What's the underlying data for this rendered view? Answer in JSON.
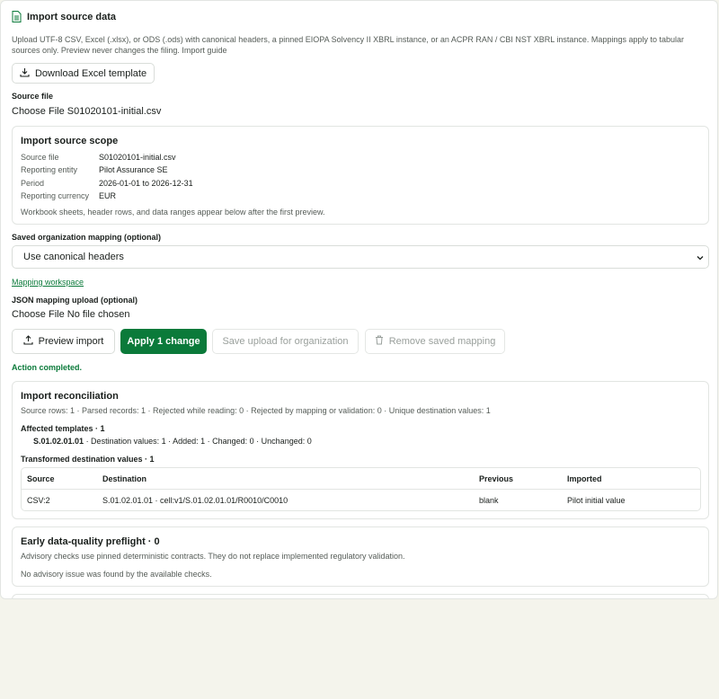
{
  "header": {
    "title": "Import source data",
    "icon": "file-spreadsheet-icon"
  },
  "description": "Upload UTF-8 CSV, Excel (.xlsx), or ODS (.ods) with canonical headers, a pinned EIOPA Solvency II XBRL instance, or an ACPR RAN / CBI NST XBRL instance. Mappings apply to tabular sources only. Preview never changes the filing. Import guide",
  "download_button": "Download Excel template",
  "source_file": {
    "label": "Source file",
    "chooser": "Choose File S01020101-initial.csv"
  },
  "scope": {
    "title": "Import source scope",
    "rows": [
      {
        "key": "Source file",
        "value": "S01020101-initial.csv"
      },
      {
        "key": "Reporting entity",
        "value": "Pilot Assurance SE"
      },
      {
        "key": "Period",
        "value": "2026-01-01 to 2026-12-31"
      },
      {
        "key": "Reporting currency",
        "value": "EUR"
      }
    ],
    "note": "Workbook sheets, header rows, and data ranges appear below after the first preview."
  },
  "saved_mapping": {
    "label": "Saved organization mapping (optional)",
    "selected": "Use canonical headers"
  },
  "mapping_link": "Mapping workspace",
  "json_mapping": {
    "label": "JSON mapping upload (optional)",
    "chooser": "Choose File No file chosen"
  },
  "actions": {
    "preview": "Preview import",
    "apply": "Apply 1 change",
    "save": "Save upload for organization",
    "remove": "Remove saved mapping"
  },
  "status": "Action completed.",
  "reconciliation": {
    "title": "Import reconciliation",
    "summary": "Source rows: 1 · Parsed records: 1 · Rejected while reading: 0 · Rejected by mapping or validation: 0 · Unique destination values: 1",
    "affected_heading": "Affected templates · 1",
    "template_code": "S.01.02.01.01",
    "template_detail": " · Destination values: 1 · Added: 1 · Changed: 0 · Unchanged: 0",
    "transformed_heading": "Transformed destination values · 1",
    "columns": [
      "Source",
      "Destination",
      "Previous",
      "Imported"
    ],
    "row": [
      "CSV:2",
      "S.01.02.01.01 · cell:v1/S.01.02.01.01/R0010/C0010",
      "blank",
      "Pilot initial value"
    ]
  },
  "preflight": {
    "title": "Early data-quality preflight · 0",
    "note": "Advisory checks use pinned deterministic contracts. They do not replace implemented regulatory validation.",
    "result": "No advisory issue was found by the available checks."
  },
  "colors": {
    "accent": "#0b7a3a",
    "background": "#f4f4ec"
  }
}
